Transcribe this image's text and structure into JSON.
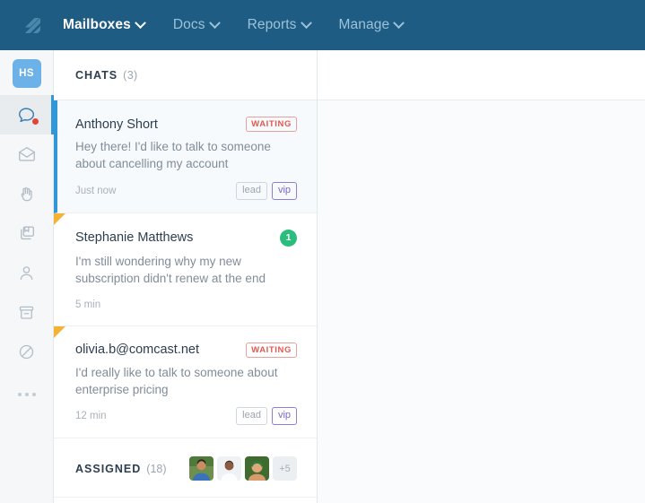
{
  "topnav": {
    "logo_name": "help-scout-logo",
    "items": [
      {
        "label": "Mailboxes",
        "active": true
      },
      {
        "label": "Docs",
        "active": false
      },
      {
        "label": "Reports",
        "active": false
      },
      {
        "label": "Manage",
        "active": false
      }
    ]
  },
  "rail": {
    "avatar_initials": "HS",
    "items": [
      {
        "name": "chat-icon",
        "active": true,
        "has_notification_dot": true
      },
      {
        "name": "envelope-icon",
        "active": false,
        "has_notification_dot": false
      },
      {
        "name": "hand-icon",
        "active": false,
        "has_notification_dot": false
      },
      {
        "name": "folders-icon",
        "active": false,
        "has_notification_dot": false
      },
      {
        "name": "person-icon",
        "active": false,
        "has_notification_dot": false
      },
      {
        "name": "archive-icon",
        "active": false,
        "has_notification_dot": false
      },
      {
        "name": "no-entry-icon",
        "active": false,
        "has_notification_dot": false
      },
      {
        "name": "more-options-icon",
        "active": false,
        "has_notification_dot": false
      }
    ]
  },
  "chat_list": {
    "header_title": "CHATS",
    "header_count": "(3)",
    "items": [
      {
        "name": "Anthony Short",
        "preview": "Hey there! I'd like to talk to someone about cancelling my account",
        "time": "Just now",
        "status_badge": "WAITING",
        "badge_type": "waiting",
        "tags": [
          "lead",
          "vip"
        ],
        "selected": true,
        "flagged": false
      },
      {
        "name": "Stephanie Matthews",
        "preview": "I'm still wondering why my new subscription didn't renew at the end",
        "time": "5 min",
        "status_badge": "1",
        "badge_type": "count",
        "tags": [],
        "selected": false,
        "flagged": true
      },
      {
        "name": "olivia.b@comcast.net",
        "preview": "I'd really like to talk to someone about enterprise pricing",
        "time": "12 min",
        "status_badge": "WAITING",
        "badge_type": "waiting",
        "tags": [
          "lead",
          "vip"
        ],
        "selected": false,
        "flagged": true
      }
    ]
  },
  "assigned": {
    "title": "ASSIGNED",
    "count": "(18)",
    "avatar_count": 3,
    "overflow_label": "+5"
  },
  "colors": {
    "nav_background": "#1f5c84",
    "accent_blue": "#3197d6",
    "avatar_blue": "#6cb2e8",
    "waiting_red": "#e05a4f",
    "count_green": "#2bbd7e",
    "vip_purple": "#7a68c4",
    "flag_orange": "#f5b335",
    "rail_background": "#f5f7f9",
    "panel_background": "#fafbfc"
  }
}
